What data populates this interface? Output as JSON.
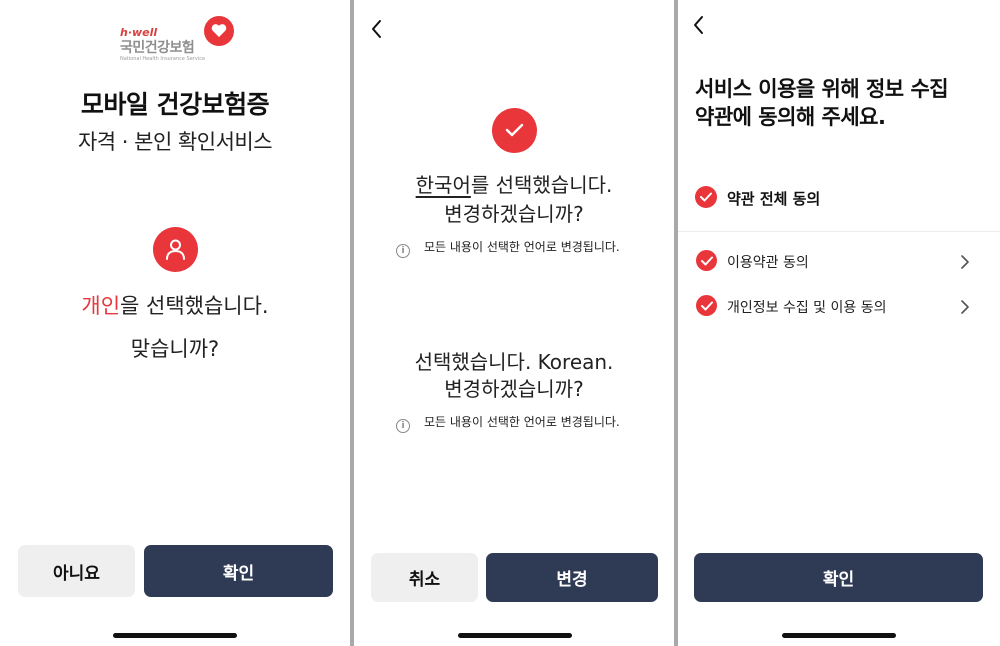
{
  "screen1": {
    "logo": {
      "brand": "h·well",
      "name": "국민건강보험",
      "name_en": "National Health Insurance Service",
      "icon": "heart-icon"
    },
    "title": "모바일 건강보험증",
    "subtitle": "자격 · 본인 확인서비스",
    "icon": "person-icon",
    "question_highlight": "개인",
    "question_rest": "을 선택했습니다.",
    "question_line2": "맞습니까?",
    "no_button": "아니요",
    "ok_button": "확인"
  },
  "screen2": {
    "back_icon": "chevron-left-icon",
    "check_icon": "check-icon",
    "q1_highlight": "한국어",
    "q1_rest": "를 선택했습니다.",
    "q1_line2": "변경하겠습니까?",
    "info1": "모든 내용이 선택한 언어로 변경됩니다.",
    "q2_line1": "선택했습니다. Korean.",
    "q2_line2": "변경하겠습니까?",
    "info2": "모든 내용이 선택한 언어로 변경됩니다.",
    "cancel_button": "취소",
    "change_button": "변경"
  },
  "screen3": {
    "back_icon": "chevron-left-icon",
    "title_line1": "서비스 이용을 위해 정보 수집",
    "title_line2": "약관에 동의해 주세요.",
    "agree_all": "약관 전체 동의",
    "items": [
      {
        "label": "이용약관 동의"
      },
      {
        "label": "개인정보 수집 및 이용 동의"
      }
    ],
    "ok_button": "확인"
  },
  "colors": {
    "accent": "#e8363b",
    "dark_button": "#2f3a54",
    "gray_button": "#efefef",
    "divider": "#a9a9a9"
  }
}
